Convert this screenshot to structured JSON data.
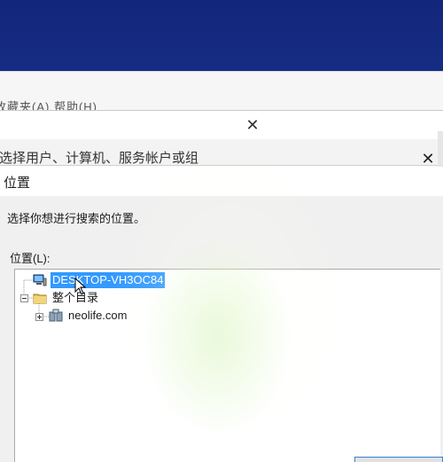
{
  "back_window": {
    "menu_text": "收藏夹(A)   帮助(H)"
  },
  "select_dialog": {
    "title": "选择用户、计算机、服务帐户或组",
    "close_label": "✕"
  },
  "location_dialog": {
    "title": "位置",
    "instruction": "选择你想进行搜索的位置。",
    "field_label": "位置(L):",
    "tree": [
      {
        "label": "DESKTOP-VH3OC84",
        "selected": true,
        "icon": "computer-icon"
      },
      {
        "label": "整个目录",
        "selected": false,
        "icon": "folder-icon"
      },
      {
        "label": "neolife.com",
        "selected": false,
        "icon": "domain-icon"
      }
    ]
  },
  "colors": {
    "selection": "#3399ff",
    "desktop_blue": "#1b3ea0"
  }
}
